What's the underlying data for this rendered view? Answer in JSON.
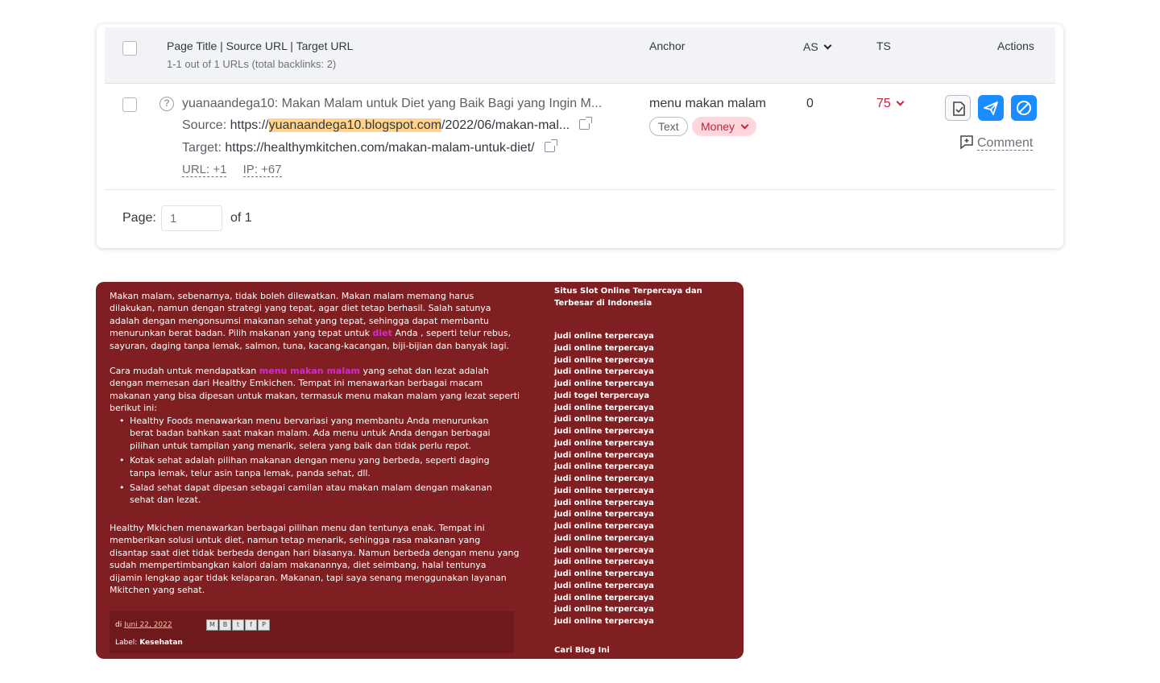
{
  "table": {
    "header": {
      "col_title": "Page Title | Source URL | Target URL",
      "col_title_sub": "1-1 out of 1 URLs (total backlinks: 2)",
      "col_anchor": "Anchor",
      "col_as": "AS",
      "col_ts": "TS",
      "col_actions": "Actions"
    },
    "row": {
      "title": "yuanaandega10: Makan Malam untuk Diet yang Baik Bagi yang Ingin M...",
      "source_label": "Source:",
      "source_prefix": "https://",
      "source_highlight": "yuanaandega10.blogspot.com",
      "source_suffix": "/2022/06/makan-mal...",
      "target_label": "Target:",
      "target_url": "https://healthymkitchen.com/makan-malam-untuk-diet/",
      "url_stat": "URL: +1",
      "ip_stat": "IP: +67",
      "anchor": "menu makan malam",
      "anchor_tag_text": "Text",
      "anchor_tag_money": "Money",
      "as_value": "0",
      "ts_value": "75",
      "comment_label": "Comment",
      "question_icon": "?"
    },
    "pager": {
      "label": "Page:",
      "input_placeholder": "1",
      "of": "of 1"
    }
  },
  "blog": {
    "p1_a": "Makan malam, sebenarnya, tidak boleh dilewatkan. Makan malam memang harus dilakukan, namun dengan strategi yang tepat, agar diet tetap berhasil. Salah satunya adalah dengan mengonsumsi makanan sehat yang tepat, sehingga dapat membantu menurunkan berat badan. Pilih makanan yang tepat untuk ",
    "p1_link": "diet",
    "p1_b": " Anda , seperti telur rebus, sayuran, daging tanpa lemak, salmon, tuna, kacang-kacangan, biji-bijian dan banyak lagi.",
    "p2_a": "Cara mudah untuk mendapatkan ",
    "p2_link": "menu makan malam",
    "p2_b": " yang sehat dan lezat adalah dengan memesan dari Healthy Emkichen. Tempat ini menawarkan berbagai macam makanan yang bisa dipesan untuk makan, termasuk menu makan malam yang lezat seperti berikut ini:",
    "list": [
      "Healthy Foods menawarkan menu bervariasi yang membantu Anda menurunkan berat badan bahkan saat makan malam. Ada menu untuk Anda dengan berbagai pilihan untuk tampilan yang menarik, selera yang baik dan tidak perlu repot.",
      "Kotak sehat adalah pilihan makanan dengan menu yang berbeda, seperti daging tanpa lemak, telur asin tanpa lemak, panda sehat, dll.",
      "Salad sehat dapat dipesan sebagai camilan atau makan malam dengan makanan sehat dan lezat."
    ],
    "p3": "Healthy Mkichen menawarkan berbagai pilihan menu dan tentunya enak. Tempat ini memberikan solusi untuk diet, namun tetap menarik, sehingga rasa makanan yang disantap saat diet tidak berbeda dengan hari biasanya. Namun berbeda dengan menu yang sudah mempertimbangkan kalori dalam makanannya, diet seimbang, halal tentunya dijamin lengkap agar tidak kelaparan. Makanan, tapi saya senang menggunakan layanan Mkitchen yang sehat.",
    "foot_di": "di",
    "foot_date": "Juni 22, 2022",
    "foot_label": "Label:",
    "foot_label_value": "Kesehatan",
    "share_icons": [
      "M",
      "B",
      "t",
      "f",
      "P"
    ],
    "side_title": "Situs Slot Online Terpercaya dan Terbesar di Indonesia",
    "side_links": [
      "judi online terpercaya",
      "judi online terpercaya",
      "judi online terpercaya",
      "judi online terpercaya",
      "judi online terpercaya",
      "judi togel terpercaya",
      "judi online terpercaya",
      "judi online terpercaya",
      "judi online terpercaya",
      "judi online terpercaya",
      "judi online terpercaya",
      "judi online terpercaya",
      "judi online terpercaya",
      "judi online terpercaya",
      "judi online terpercaya",
      "judi online terpercaya",
      "judi online terpercaya",
      "judi online terpercaya",
      "judi online terpercaya",
      "judi online terpercaya",
      "judi online terpercaya",
      "judi online terpercaya",
      "judi online terpercaya",
      "judi online terpercaya",
      "judi online terpercaya"
    ],
    "side_bottom": "Cari Blog Ini"
  },
  "colors": {
    "accent_blue": "#1a8cff",
    "ts_red": "#c0233b",
    "money_pink": "#ffd6dc",
    "highlight": "#ffd48a",
    "blog_bg": "#7f1f22",
    "blog_link": "#d42bd0"
  },
  "icons": {
    "question": "question-circle-icon",
    "external": "external-link-icon",
    "chevron": "chevron-down-icon",
    "action1": "document-review-icon",
    "action2": "send-icon",
    "action3": "block-icon",
    "comment": "add-comment-icon"
  }
}
